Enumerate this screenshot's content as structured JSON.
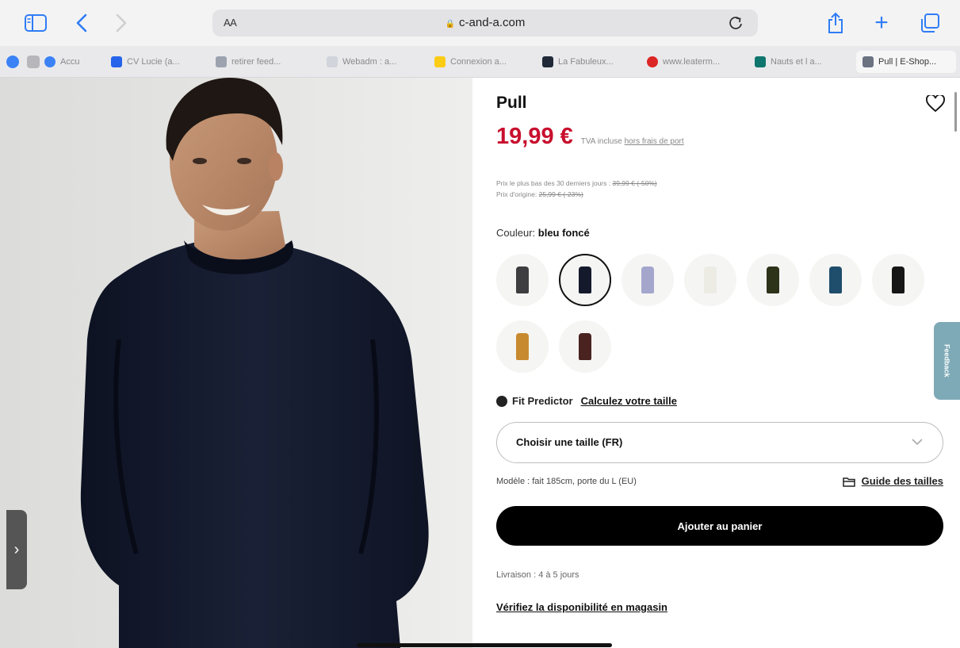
{
  "browser": {
    "text_size_label": "AA",
    "url": "c-and-a.com",
    "tabs": [
      {
        "label": "Accu",
        "color": "#3b82f6"
      },
      {
        "label": "CV Lucie (a...",
        "color": "#2563eb"
      },
      {
        "label": "retirer feed...",
        "color": "#9ca3af"
      },
      {
        "label": "Webadm : a...",
        "color": "#d1d5db"
      },
      {
        "label": "Connexion a...",
        "color": "#facc15"
      },
      {
        "label": "La Fabuleux...",
        "color": "#1f2937"
      },
      {
        "label": "www.leaterm...",
        "color": "#dc2626"
      },
      {
        "label": "Nauts et l a...",
        "color": "#0f766e"
      },
      {
        "label": "Pull | E-Shop...",
        "color": "#6b7280"
      }
    ]
  },
  "product": {
    "title": "Pull",
    "price": "19,99 €",
    "tva_prefix": "TVA incluse",
    "tva_link": "hors frais de port",
    "lowest_price_text": "Prix le plus bas des 30 derniers jours :",
    "lowest_price_old": "39,99 € (-50%)",
    "original_price_text": "Prix d'origine:",
    "original_price_old": "25,99 € (-23%)",
    "color_prefix": "Couleur:",
    "color_value": "bleu foncé",
    "swatches": [
      {
        "name": "gris foncé",
        "color": "#3e3e40",
        "selected": false
      },
      {
        "name": "bleu foncé",
        "color": "#141a2c",
        "selected": true
      },
      {
        "name": "lavande",
        "color": "#a4a6cc",
        "selected": false
      },
      {
        "name": "blanc cassé",
        "color": "#ecebe4",
        "selected": false
      },
      {
        "name": "kaki",
        "color": "#2d3319",
        "selected": false
      },
      {
        "name": "bleu pétrole",
        "color": "#1f4e6c",
        "selected": false
      },
      {
        "name": "noir",
        "color": "#161616",
        "selected": false
      },
      {
        "name": "moutarde",
        "color": "#c88a2e",
        "selected": false
      },
      {
        "name": "bordeaux",
        "color": "#4a2320",
        "selected": false
      }
    ],
    "fit_label": "Fit Predictor",
    "fit_link": "Calculez votre taille",
    "size_select_label": "Choisir une taille (FR)",
    "model_text": "Modèle : fait 185cm, porte du L (EU)",
    "size_guide": "Guide des tailles",
    "add_to_cart": "Ajouter au panier",
    "delivery": "Livraison : 4 à 5 jours",
    "store_check": "Vérifiez la disponibilité en magasin",
    "feedback": "Feedback"
  }
}
